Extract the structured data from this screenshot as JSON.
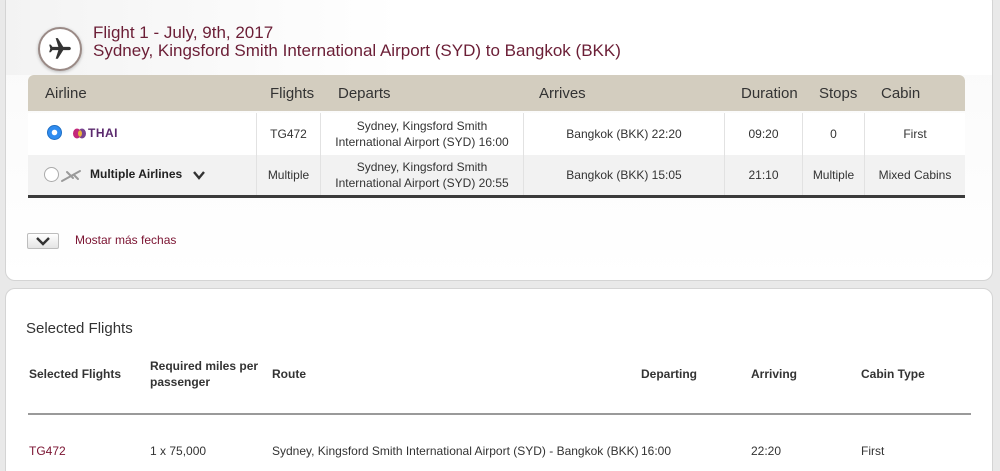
{
  "flight": {
    "title_line1": "Flight 1 - July, 9th, 2017",
    "title_line2": "Sydney, Kingsford Smith International Airport (SYD) to Bangkok (BKK)",
    "icon": "plane-icon"
  },
  "table": {
    "headers": [
      "Airline",
      "Flights",
      "Departs",
      "Arrives",
      "Duration",
      "Stops",
      "Cabin"
    ],
    "rows": [
      {
        "airline": "THAI",
        "flights": "TG472",
        "departs_line1": "Sydney, Kingsford Smith",
        "departs_line2": "International Airport (SYD) 16:00",
        "arrives": "Bangkok (BKK) 22:20",
        "duration": "09:20",
        "stops": "0",
        "cabin": "First",
        "selected": true
      },
      {
        "airline": "Multiple Airlines",
        "flights": "Multiple",
        "departs_line1": "Sydney, Kingsford Smith",
        "departs_line2": "International Airport (SYD) 20:55",
        "arrives": "Bangkok (BKK) 15:05",
        "duration": "21:10",
        "stops": "Multiple",
        "cabin": "Mixed Cabins",
        "selected": false
      }
    ]
  },
  "more_dates": {
    "label": "Mostar más fechas"
  },
  "selected": {
    "title": "Selected Flights",
    "headers": {
      "flights": "Selected Flights",
      "miles_line1": "Required miles per",
      "miles_line2": "passenger",
      "route": "Route",
      "departing": "Departing",
      "arriving": "Arriving",
      "cabin": "Cabin Type"
    },
    "row": {
      "flight": "TG472",
      "miles": "1 x 75,000",
      "route": "Sydney, Kingsford Smith International Airport (SYD) - Bangkok (BKK)",
      "departing": "16:00",
      "arriving": "22:20",
      "cabin": "First"
    }
  },
  "colors": {
    "title": "#6b1e36",
    "header_bg": "#d3cdbf",
    "link": "#7a1230",
    "radio_selected": "#2f8cf0"
  }
}
